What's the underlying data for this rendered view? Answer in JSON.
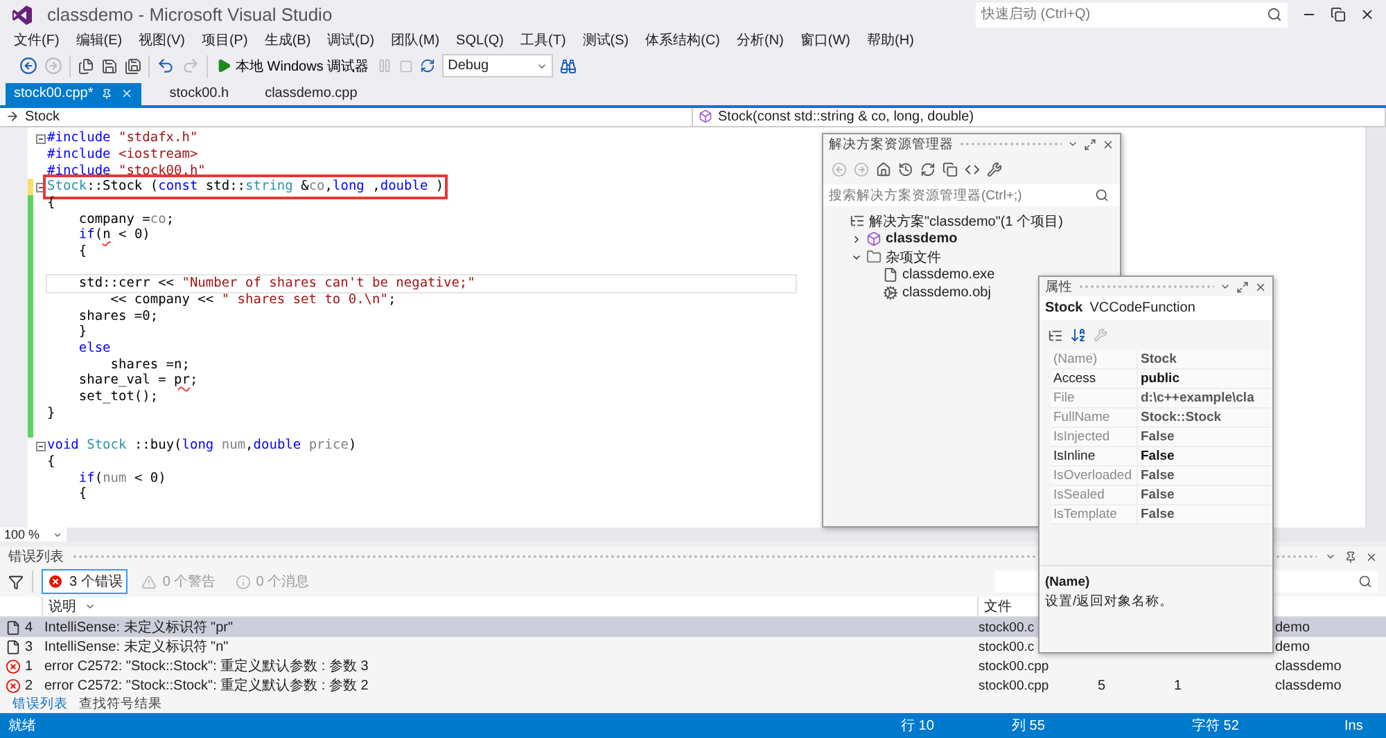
{
  "window": {
    "title": "classdemo - Microsoft Visual Studio",
    "quick_launch": {
      "placeholder": "快速启动 (Ctrl+Q)"
    }
  },
  "menu": [
    "文件(F)",
    "编辑(E)",
    "视图(V)",
    "项目(P)",
    "生成(B)",
    "调试(D)",
    "团队(M)",
    "SQL(Q)",
    "工具(T)",
    "测试(S)",
    "体系结构(C)",
    "分析(N)",
    "窗口(W)",
    "帮助(H)"
  ],
  "toolbar": {
    "debugger": "本地 Windows 调试器",
    "configuration": "Debug"
  },
  "tabs": [
    {
      "label": "stock00.cpp*",
      "selected": true
    },
    {
      "label": "stock00.h",
      "selected": false
    },
    {
      "label": "classdemo.cpp",
      "selected": false
    }
  ],
  "navigation": {
    "scope": "Stock",
    "member": "Stock(const std::string & co, long, double)"
  },
  "editor": {
    "zoom": "100 %",
    "lines": [
      {
        "fold": true,
        "changed": false,
        "tokens": [
          {
            "kind": "keyword",
            "text": "#include"
          },
          {
            "kind": "string",
            "text": " \"stdafx.h\""
          }
        ]
      },
      {
        "changed": false,
        "tokens": [
          {
            "kind": "keyword",
            "text": "#include"
          },
          {
            "kind": "string",
            "text": " <iostream>"
          }
        ]
      },
      {
        "changed": false,
        "tokens": [
          {
            "kind": "keyword",
            "text": "#include"
          },
          {
            "kind": "string",
            "text": " \"stock00.h\""
          }
        ]
      },
      {
        "fold": true,
        "highlighted": true,
        "changed": true,
        "saved": false,
        "tokens": [
          {
            "kind": "type",
            "text": "Stock"
          },
          {
            "kind": "plain",
            "text": "::Stock ("
          },
          {
            "kind": "keyword",
            "text": "const"
          },
          {
            "kind": "plain",
            "text": " std::"
          },
          {
            "kind": "type",
            "text": "string"
          },
          {
            "kind": "plain",
            "text": " &"
          },
          {
            "kind": "param",
            "text": "co"
          },
          {
            "kind": "plain",
            "text": ","
          },
          {
            "kind": "keyword",
            "text": "long"
          },
          {
            "kind": "plain",
            "text": " ,"
          },
          {
            "kind": "keyword",
            "text": "double"
          },
          {
            "kind": "plain",
            "text": " )"
          }
        ]
      },
      {
        "changed": true,
        "saved": true,
        "tokens": [
          {
            "kind": "plain",
            "text": "{"
          }
        ]
      },
      {
        "changed": true,
        "saved": true,
        "tokens": [
          {
            "kind": "plain",
            "text": "    company ="
          },
          {
            "kind": "param",
            "text": "co"
          },
          {
            "kind": "plain",
            "text": ";"
          }
        ]
      },
      {
        "changed": true,
        "saved": true,
        "tokens": [
          {
            "kind": "keyword",
            "text": "    if"
          },
          {
            "kind": "plain",
            "text": "("
          },
          {
            "kind": "error",
            "text": "n"
          },
          {
            "kind": "plain",
            "text": " < 0)"
          }
        ]
      },
      {
        "changed": true,
        "saved": true,
        "tokens": [
          {
            "kind": "plain",
            "text": "    {"
          }
        ]
      },
      {
        "changed": true,
        "saved": true
      },
      {
        "changed": true,
        "saved": true,
        "current": true,
        "tokens": [
          {
            "kind": "plain",
            "text": "    std::cerr << "
          },
          {
            "kind": "string",
            "text": "\"Number of shares can't be negative;\""
          }
        ]
      },
      {
        "changed": true,
        "saved": true,
        "tokens": [
          {
            "kind": "plain",
            "text": "        << company << "
          },
          {
            "kind": "string",
            "text": "\" shares set to 0.\\n\""
          },
          {
            "kind": "plain",
            "text": ";"
          }
        ]
      },
      {
        "changed": true,
        "saved": true,
        "tokens": [
          {
            "kind": "plain",
            "text": "    shares =0;"
          }
        ]
      },
      {
        "changed": true,
        "saved": true,
        "tokens": [
          {
            "kind": "plain",
            "text": "    }"
          }
        ]
      },
      {
        "changed": true,
        "saved": true,
        "tokens": [
          {
            "kind": "keyword",
            "text": "    else"
          }
        ]
      },
      {
        "changed": true,
        "saved": true,
        "tokens": [
          {
            "kind": "plain",
            "text": "        shares =n;"
          }
        ]
      },
      {
        "changed": true,
        "saved": true,
        "tokens": [
          {
            "kind": "plain",
            "text": "    share_val = "
          },
          {
            "kind": "error",
            "text": "pr"
          },
          {
            "kind": "plain",
            "text": ";"
          }
        ]
      },
      {
        "changed": true,
        "saved": true,
        "tokens": [
          {
            "kind": "plain",
            "text": "    set_tot();"
          }
        ]
      },
      {
        "changed": true,
        "saved": true,
        "tokens": [
          {
            "kind": "plain",
            "text": "}"
          }
        ]
      },
      {
        "changed": true,
        "saved": true
      },
      {
        "fold": true,
        "changed": false,
        "tokens": [
          {
            "kind": "keyword",
            "text": "void"
          },
          {
            "kind": "type",
            "text": " Stock"
          },
          {
            "kind": "plain",
            "text": " ::buy("
          },
          {
            "kind": "keyword",
            "text": "long"
          },
          {
            "kind": "param",
            "text": " num"
          },
          {
            "kind": "plain",
            "text": ","
          },
          {
            "kind": "keyword",
            "text": "double"
          },
          {
            "kind": "param",
            "text": " price"
          },
          {
            "kind": "plain",
            "text": ")"
          }
        ]
      },
      {
        "changed": false,
        "tokens": [
          {
            "kind": "plain",
            "text": "{"
          }
        ]
      },
      {
        "changed": false,
        "tokens": [
          {
            "kind": "keyword",
            "text": "    if"
          },
          {
            "kind": "plain",
            "text": "("
          },
          {
            "kind": "param",
            "text": "num"
          },
          {
            "kind": "plain",
            "text": " < 0)"
          }
        ]
      },
      {
        "changed": false,
        "tokens": [
          {
            "kind": "plain",
            "text": "    {"
          }
        ]
      }
    ]
  },
  "solution_explorer": {
    "title": "解决方案资源管理器",
    "search": {
      "placeholder": "搜索解决方案资源管理器(Ctrl+;)"
    },
    "tree": [
      {
        "label": "解决方案\"classdemo\"(1 个项目)",
        "kind": "solution",
        "children": [
          {
            "label": "classdemo",
            "kind": "project",
            "bold": true,
            "expanded": false
          },
          {
            "label": "杂项文件",
            "kind": "folder",
            "bold": false,
            "expanded": true,
            "children": [
              {
                "label": "classdemo.exe",
                "kind": "file"
              },
              {
                "label": "classdemo.obj",
                "kind": "object"
              }
            ]
          }
        ]
      }
    ]
  },
  "properties": {
    "title": "属性",
    "object": "Stock",
    "object_type": "VCCodeFunction",
    "rows": [
      {
        "name": "(Name)",
        "value": "Stock",
        "readonly": true
      },
      {
        "name": "Access",
        "value": "public",
        "readonly": false
      },
      {
        "name": "File",
        "value": "d:\\c++example\\cla",
        "readonly": true
      },
      {
        "name": "FullName",
        "value": "Stock::Stock",
        "readonly": true
      },
      {
        "name": "IsInjected",
        "value": "False",
        "readonly": true
      },
      {
        "name": "IsInline",
        "value": "False",
        "readonly": false
      },
      {
        "name": "IsOverloaded",
        "value": "False",
        "readonly": true
      },
      {
        "name": "IsSealed",
        "value": "False",
        "readonly": true
      },
      {
        "name": "IsTemplate",
        "value": "False",
        "readonly": true
      }
    ],
    "description": {
      "title": "(Name)",
      "text": "设置/返回对象名称。"
    }
  },
  "error_list": {
    "title": "错误列表",
    "filters": [
      {
        "kind": "error",
        "label": "3 个错误",
        "selected": true
      },
      {
        "kind": "warning",
        "label": "0 个警告",
        "selected": false
      },
      {
        "kind": "message",
        "label": "0 个消息",
        "selected": false
      }
    ],
    "columns": [
      "说明",
      "文件"
    ],
    "rows": [
      {
        "kind": "intellisense",
        "num": "4",
        "text": "IntelliSense: 未定义标识符 \"pr\"",
        "file": "stock00.c",
        "project": "demo",
        "selected": true
      },
      {
        "kind": "intellisense",
        "num": "3",
        "text": "IntelliSense: 未定义标识符 \"n\"",
        "file": "stock00.c",
        "project": "demo",
        "selected": false
      },
      {
        "kind": "error",
        "num": "1",
        "text": "error C2572: \"Stock::Stock\": 重定义默认参数 : 参数 3",
        "file": "stock00.cpp",
        "project": "classdemo",
        "selected": false
      },
      {
        "kind": "error",
        "num": "2",
        "text": "error C2572: \"Stock::Stock\": 重定义默认参数 : 参数 2",
        "file": "stock00.cpp",
        "line": "5",
        "column": "1",
        "project": "classdemo",
        "selected": false
      }
    ],
    "bottom_tabs": [
      {
        "label": "错误列表",
        "selected": true
      },
      {
        "label": "查找符号结果",
        "selected": false
      }
    ]
  },
  "status_bar": {
    "message": "就绪",
    "line": "行 10",
    "column": "列 55",
    "char": "字符 52",
    "mode": "Ins"
  }
}
